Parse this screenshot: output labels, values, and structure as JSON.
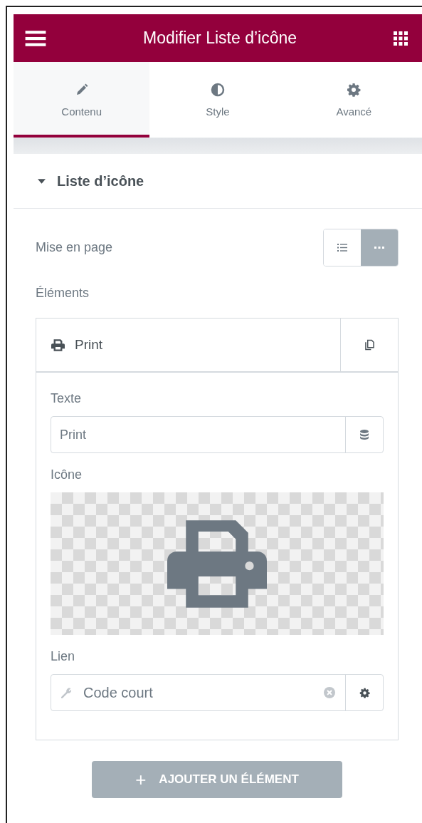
{
  "header": {
    "title": "Modifier Liste d’icône"
  },
  "tabs": [
    {
      "label": "Contenu",
      "selected": true
    },
    {
      "label": "Style",
      "selected": false
    },
    {
      "label": "Avancé",
      "selected": false
    }
  ],
  "section": {
    "title": "Liste d’icône",
    "expanded": true
  },
  "layout": {
    "label": "Mise en page",
    "options": [
      {
        "kind": "list",
        "selected": false
      },
      {
        "kind": "inline",
        "selected": true
      }
    ]
  },
  "elements": {
    "label": "Éléments",
    "items": [
      {
        "title": "Print",
        "expanded": true,
        "text_label": "Texte",
        "text_value": "Print",
        "icon_label": "Icône",
        "link_label": "Lien",
        "link_value": "Code court"
      }
    ]
  },
  "add_button": {
    "plus": "+",
    "label": "AJOUTER UN ÉLÉMENT"
  }
}
